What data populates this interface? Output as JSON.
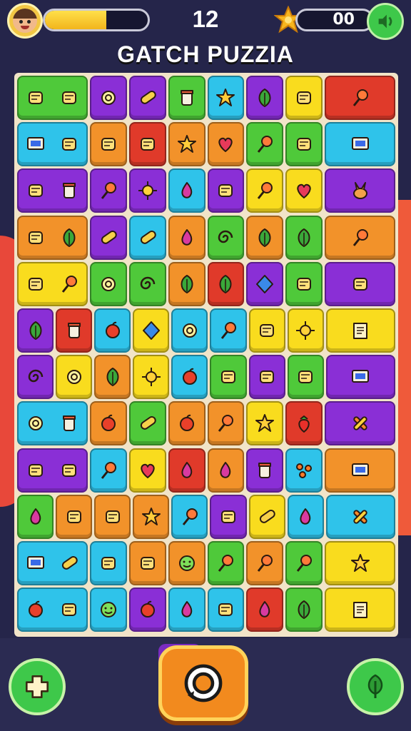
{
  "hud": {
    "level_number": "12",
    "coin_count": "00",
    "progress_fraction": 0.6
  },
  "title": "GATCH PUZZIA",
  "colors": {
    "green": "#4fc93a",
    "purple": "#8a2fd6",
    "blue": "#2fc3ea",
    "orange": "#f2922a",
    "yellow": "#f9dc1e",
    "red": "#e03a2a",
    "pink": "#d83aa0"
  },
  "icons": {
    "left_button": "cheese-puzzle-icon",
    "center_button": "rotate-icon",
    "right_button": "leaf-icon",
    "sound_button": "sound-icon"
  },
  "board": {
    "rows": [
      [
        {
          "c": "green",
          "s": 2,
          "icons": [
            "candy-icon",
            "arrow-icon"
          ]
        },
        {
          "c": "purple",
          "icons": [
            "ring-icon"
          ]
        },
        {
          "c": "purple",
          "icons": [
            "capsule-icon"
          ]
        },
        {
          "c": "green",
          "icons": [
            "cup-icon"
          ]
        },
        {
          "c": "blue",
          "icons": [
            "star-icon"
          ]
        },
        {
          "c": "purple",
          "icons": [
            "leaf-icon"
          ]
        },
        {
          "c": "yellow",
          "icons": [
            "bag-icon"
          ]
        },
        {
          "c": "red",
          "s": 2,
          "icons": [
            "dropper-icon"
          ]
        }
      ],
      [
        {
          "c": "blue",
          "s": 2,
          "icons": [
            "monitor-icon",
            "bottles-icon"
          ]
        },
        {
          "c": "orange",
          "icons": [
            "sponge-icon"
          ]
        },
        {
          "c": "red",
          "icons": [
            "book-icon"
          ]
        },
        {
          "c": "orange",
          "icons": [
            "burst-icon"
          ]
        },
        {
          "c": "orange",
          "icons": [
            "heart-icon"
          ]
        },
        {
          "c": "green",
          "icons": [
            "lollipop-icon"
          ]
        },
        {
          "c": "green",
          "icons": [
            "grape-icon"
          ]
        },
        {
          "c": "blue",
          "s": 2,
          "icons": [
            "device-icon"
          ]
        }
      ],
      [
        {
          "c": "purple",
          "s": 2,
          "icons": [
            "watch-icon",
            "jar-icon"
          ]
        },
        {
          "c": "purple",
          "icons": [
            "lollipop-icon"
          ]
        },
        {
          "c": "purple",
          "icons": [
            "sun-icon"
          ]
        },
        {
          "c": "blue",
          "icons": [
            "drop-icon"
          ]
        },
        {
          "c": "purple",
          "icons": [
            "blob-icon"
          ]
        },
        {
          "c": "yellow",
          "icons": [
            "popsicle-icon"
          ]
        },
        {
          "c": "yellow",
          "icons": [
            "heart-icon"
          ]
        },
        {
          "c": "purple",
          "s": 2,
          "icons": [
            "bunny-icon"
          ]
        }
      ],
      [
        {
          "c": "orange",
          "s": 2,
          "icons": [
            "tree-icon",
            "leaf-icon"
          ]
        },
        {
          "c": "purple",
          "icons": [
            "capsule-icon"
          ]
        },
        {
          "c": "blue",
          "icons": [
            "bandage-icon"
          ]
        },
        {
          "c": "orange",
          "icons": [
            "drop-icon"
          ]
        },
        {
          "c": "green",
          "icons": [
            "swirl-icon"
          ]
        },
        {
          "c": "orange",
          "icons": [
            "feather-icon"
          ]
        },
        {
          "c": "green",
          "icons": [
            "leaf-icon"
          ]
        },
        {
          "c": "orange",
          "s": 2,
          "icons": [
            "popsicle-icon"
          ]
        }
      ],
      [
        {
          "c": "yellow",
          "s": 2,
          "icons": [
            "tree-icon",
            "lollipop-icon"
          ]
        },
        {
          "c": "green",
          "icons": [
            "ring-icon"
          ]
        },
        {
          "c": "green",
          "icons": [
            "knot-icon"
          ]
        },
        {
          "c": "orange",
          "icons": [
            "leaf-icon"
          ]
        },
        {
          "c": "red",
          "icons": [
            "feather-icon"
          ]
        },
        {
          "c": "purple",
          "icons": [
            "gem-icon"
          ]
        },
        {
          "c": "green",
          "icons": [
            "lemon-icon"
          ]
        },
        {
          "c": "purple",
          "s": 2,
          "icons": [
            "watch-icon"
          ]
        }
      ],
      [
        {
          "c": "purple",
          "icons": [
            "leaf-icon"
          ]
        },
        {
          "c": "red",
          "icons": [
            "cup-icon"
          ]
        },
        {
          "c": "blue",
          "icons": [
            "ball-icon"
          ]
        },
        {
          "c": "yellow",
          "icons": [
            "diamond-icon"
          ]
        },
        {
          "c": "blue",
          "icons": [
            "ring-icon"
          ]
        },
        {
          "c": "blue",
          "icons": [
            "lollipop-icon"
          ]
        },
        {
          "c": "yellow",
          "icons": [
            "fish-icon"
          ]
        },
        {
          "c": "yellow",
          "icons": [
            "gear-icon"
          ]
        },
        {
          "c": "yellow",
          "s": 2,
          "icons": [
            "note-icon"
          ]
        }
      ],
      [
        {
          "c": "purple",
          "icons": [
            "knot-icon"
          ]
        },
        {
          "c": "yellow",
          "icons": [
            "ring-icon"
          ]
        },
        {
          "c": "orange",
          "icons": [
            "leaf-icon"
          ]
        },
        {
          "c": "yellow",
          "icons": [
            "gear-icon"
          ]
        },
        {
          "c": "blue",
          "icons": [
            "apple-icon"
          ]
        },
        {
          "c": "green",
          "icons": [
            "carrot-icon"
          ]
        },
        {
          "c": "purple",
          "icons": [
            "spoon-icon"
          ]
        },
        {
          "c": "green",
          "icons": [
            "lemon-icon"
          ]
        },
        {
          "c": "purple",
          "s": 2,
          "icons": [
            "camera-icon"
          ]
        }
      ],
      [
        {
          "c": "blue",
          "s": 2,
          "icons": [
            "search-icon",
            "jar-icon"
          ]
        },
        {
          "c": "orange",
          "icons": [
            "apple-icon"
          ]
        },
        {
          "c": "green",
          "icons": [
            "crayon-icon"
          ]
        },
        {
          "c": "orange",
          "icons": [
            "apple-icon"
          ]
        },
        {
          "c": "orange",
          "icons": [
            "popsicle-icon"
          ]
        },
        {
          "c": "yellow",
          "icons": [
            "star-icon"
          ]
        },
        {
          "c": "red",
          "icons": [
            "strawberry-icon"
          ]
        },
        {
          "c": "purple",
          "s": 2,
          "icons": [
            "ribbon-icon"
          ]
        }
      ],
      [
        {
          "c": "purple",
          "s": 2,
          "icons": [
            "sponge-icon",
            "cheese-icon"
          ]
        },
        {
          "c": "blue",
          "icons": [
            "lollipop-icon"
          ]
        },
        {
          "c": "yellow",
          "icons": [
            "heart-icon"
          ]
        },
        {
          "c": "red",
          "icons": [
            "drop-icon"
          ]
        },
        {
          "c": "orange",
          "icons": [
            "drop-icon"
          ]
        },
        {
          "c": "purple",
          "icons": [
            "cup-icon"
          ]
        },
        {
          "c": "blue",
          "icons": [
            "dots-icon"
          ]
        },
        {
          "c": "orange",
          "s": 2,
          "icons": [
            "device-icon"
          ]
        }
      ],
      [
        {
          "c": "green",
          "icons": [
            "bean-icon"
          ]
        },
        {
          "c": "orange",
          "icons": [
            "bow-icon"
          ]
        },
        {
          "c": "orange",
          "icons": [
            "plug-icon"
          ]
        },
        {
          "c": "orange",
          "icons": [
            "burst-icon"
          ]
        },
        {
          "c": "blue",
          "icons": [
            "dropper-icon"
          ]
        },
        {
          "c": "purple",
          "icons": [
            "mirror-icon"
          ]
        },
        {
          "c": "yellow",
          "icons": [
            "pencil-icon"
          ]
        },
        {
          "c": "blue",
          "icons": [
            "bean-icon"
          ]
        },
        {
          "c": "blue",
          "s": 2,
          "icons": [
            "cross-icon"
          ]
        }
      ],
      [
        {
          "c": "blue",
          "s": 2,
          "icons": [
            "monitor-icon",
            "crayon-icon"
          ]
        },
        {
          "c": "blue",
          "icons": [
            "flag-icon"
          ]
        },
        {
          "c": "orange",
          "icons": [
            "cheese-icon"
          ]
        },
        {
          "c": "orange",
          "icons": [
            "face-icon"
          ]
        },
        {
          "c": "green",
          "icons": [
            "popsicle-icon"
          ]
        },
        {
          "c": "orange",
          "icons": [
            "lollipop-icon"
          ]
        },
        {
          "c": "green",
          "icons": [
            "dropper-icon"
          ]
        },
        {
          "c": "yellow",
          "s": 2,
          "icons": [
            "burst-icon"
          ]
        }
      ],
      [
        {
          "c": "blue",
          "s": 2,
          "icons": [
            "ball-icon",
            "candy-icon"
          ]
        },
        {
          "c": "blue",
          "icons": [
            "face-icon"
          ]
        },
        {
          "c": "purple",
          "icons": [
            "ball-icon"
          ]
        },
        {
          "c": "blue",
          "icons": [
            "bean-icon"
          ]
        },
        {
          "c": "blue",
          "icons": [
            "plug-icon"
          ]
        },
        {
          "c": "red",
          "icons": [
            "bean-icon"
          ]
        },
        {
          "c": "green",
          "icons": [
            "leaf-icon"
          ]
        },
        {
          "c": "yellow",
          "s": 2,
          "icons": [
            "envelope-icon"
          ]
        }
      ]
    ]
  }
}
